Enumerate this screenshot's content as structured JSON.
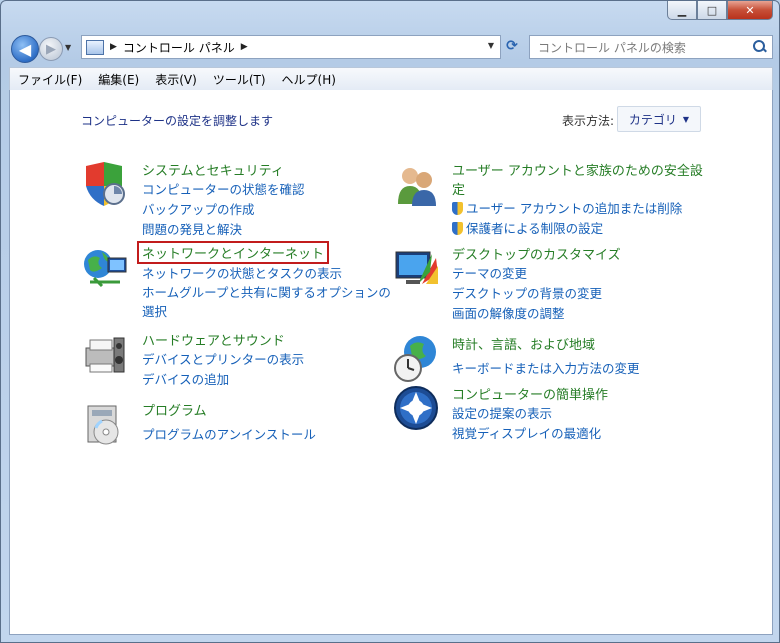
{
  "window": {
    "controls": {
      "minimize": "▁",
      "maximize": "□",
      "close": "✕"
    }
  },
  "nav": {
    "back": "◀",
    "forward": "▶",
    "address_path": "コントロール パネル",
    "search_placeholder": "コントロール パネルの検索"
  },
  "menu": [
    "ファイル(F)",
    "編集(E)",
    "表示(V)",
    "ツール(T)",
    "ヘルプ(H)"
  ],
  "content": {
    "heading": "コンピューターの設定を調整します",
    "view_label": "表示方法:",
    "view_value": "カテゴリ"
  },
  "categories": {
    "system": {
      "title": "システムとセキュリティ",
      "links": [
        "コンピューターの状態を確認",
        "バックアップの作成",
        "問題の発見と解決"
      ]
    },
    "network": {
      "title": "ネットワークとインターネット",
      "links": [
        "ネットワークの状態とタスクの表示",
        "ホームグループと共有に関するオプションの",
        "選択"
      ]
    },
    "hardware": {
      "title": "ハードウェアとサウンド",
      "links": [
        "デバイスとプリンターの表示",
        "デバイスの追加"
      ]
    },
    "programs": {
      "title": "プログラム",
      "links": [
        "プログラムのアンインストール"
      ]
    },
    "users": {
      "title_line1": "ユーザー アカウントと家族のための安全設",
      "title_line2": "定",
      "links": [
        "ユーザー アカウントの追加または削除",
        "保護者による制限の設定"
      ]
    },
    "appearance": {
      "title": "デスクトップのカスタマイズ",
      "links": [
        "テーマの変更",
        "デスクトップの背景の変更",
        "画面の解像度の調整"
      ]
    },
    "clock": {
      "title": "時計、言語、および地域",
      "links": [
        "キーボードまたは入力方法の変更"
      ]
    },
    "ease": {
      "title": "コンピューターの簡単操作",
      "links": [
        "設定の提案の表示",
        "視覚ディスプレイの最適化"
      ]
    }
  }
}
